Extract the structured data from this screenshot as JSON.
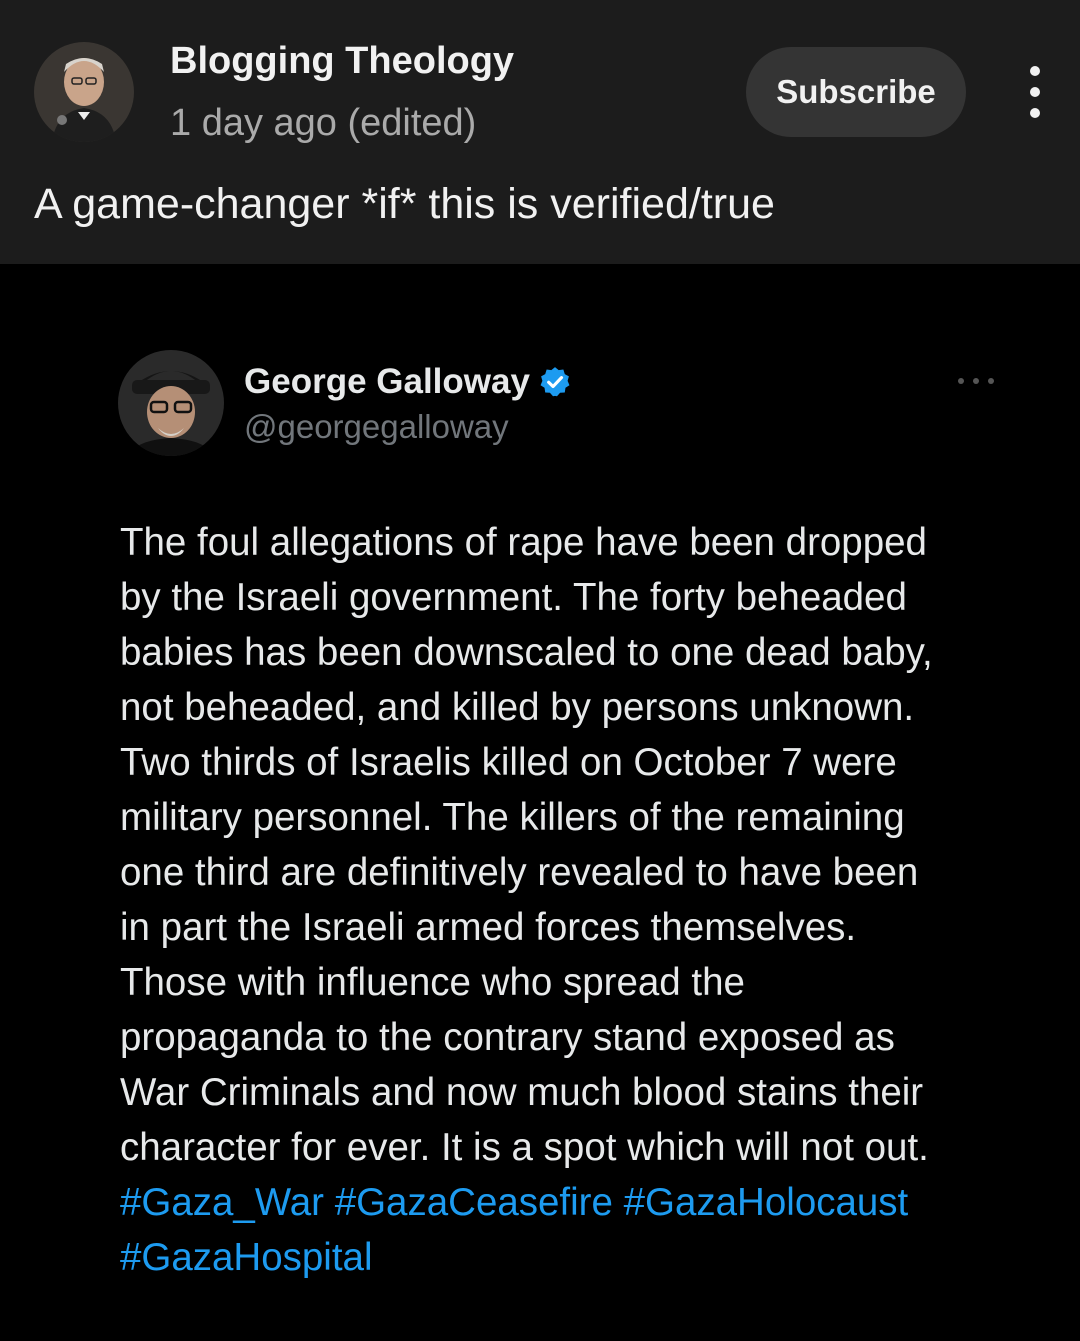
{
  "post": {
    "channel_name": "Blogging Theology",
    "time": "1 day ago (edited)",
    "subscribe_label": "Subscribe",
    "text": "A game-changer *if* this is verified/true"
  },
  "tweet": {
    "name": "George Galloway",
    "handle": "@georgegalloway",
    "body_lines": [
      "The foul allegations of rape have been dropped",
      "by the Israeli government. The forty beheaded",
      "babies has been downscaled to one dead baby,",
      "not beheaded, and killed by persons unknown.",
      "Two thirds of Israelis killed on October 7 were",
      "military personnel. The killers of the remaining",
      "one third are definitively revealed to have been",
      "in part the Israeli armed forces themselves.",
      "Those with influence who spread the",
      "propaganda to the contrary stand exposed as",
      "War Criminals and now much blood stains their",
      "character for ever. It is a spot which will not out."
    ],
    "hashtags": [
      "#Gaza_War",
      "#GazaCeasefire",
      "#GazaHolocaust",
      "#GazaHospital"
    ]
  },
  "icons": {
    "more": "vertical-ellipsis-icon",
    "verified": "verified-badge-icon",
    "tweet_more": "horizontal-ellipsis-icon"
  },
  "colors": {
    "hashtag": "#1d9bf0",
    "verified": "#1d9bf0",
    "header_bg": "#1c1c1c"
  }
}
